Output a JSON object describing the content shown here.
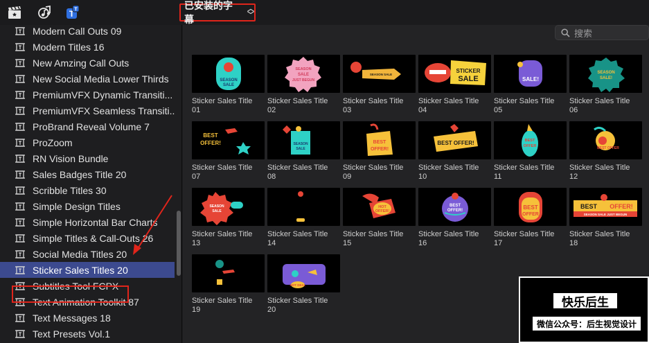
{
  "toolbar": {
    "icons": [
      "clapper-icon",
      "music-icon",
      "titles-icon"
    ],
    "browser_dropdown": "已安装的字幕",
    "accent_color": "#e0251b"
  },
  "sidebar": {
    "items": [
      {
        "label": "Modern Call Outs 09"
      },
      {
        "label": "Modern Titles 16"
      },
      {
        "label": "New Amzing Call Outs"
      },
      {
        "label": "New Social Media Lower Thirds"
      },
      {
        "label": "PremiumVFX Dynamic Transiti..."
      },
      {
        "label": "PremiumVFX Seamless Transiti..."
      },
      {
        "label": "ProBrand Reveal Volume 7"
      },
      {
        "label": "ProZoom"
      },
      {
        "label": "RN Vision Bundle"
      },
      {
        "label": "Sales Badges Title 20"
      },
      {
        "label": "Scribble Titles 30"
      },
      {
        "label": "Simple Design Titles"
      },
      {
        "label": "Simple Horizontal Bar Charts"
      },
      {
        "label": "Simple Titles & Call-Outs 26"
      },
      {
        "label": "Social Media Titles 20"
      },
      {
        "label": "Sticker Sales Titles 20",
        "selected": true
      },
      {
        "label": "Subtitles Tool FCPX"
      },
      {
        "label": "Text Animation Toolkit 87"
      },
      {
        "label": "Text Messages 18"
      },
      {
        "label": "Text Presets Vol.1"
      }
    ],
    "selected_color": "#3c4a8f"
  },
  "search": {
    "placeholder": "搜索"
  },
  "clips": [
    {
      "line1": "Sticker Sales Title",
      "line2": "01",
      "thumb_text": "SEASON SALE"
    },
    {
      "line1": "Sticker Sales Title",
      "line2": "02",
      "thumb_text": "SEASON SALE JUST BEGUN"
    },
    {
      "line1": "Sticker Sales Title",
      "line2": "03",
      "thumb_text": "SEASON SALE JUST BEGUN"
    },
    {
      "line1": "Sticker Sales Title",
      "line2": "04",
      "thumb_text": "STICKER SALE"
    },
    {
      "line1": "Sticker Sales Title",
      "line2": "05",
      "thumb_text": "SALE!"
    },
    {
      "line1": "Sticker Sales Title",
      "line2": "06",
      "thumb_text": "SEASON SALE!"
    },
    {
      "line1": "Sticker Sales Title",
      "line2": "07",
      "thumb_text": "BEST OFFER!"
    },
    {
      "line1": "Sticker Sales Title",
      "line2": "08",
      "thumb_text": "SEASON SALE"
    },
    {
      "line1": "Sticker Sales Title",
      "line2": "09",
      "thumb_text": "BEST OFFER!"
    },
    {
      "line1": "Sticker Sales Title",
      "line2": "10",
      "thumb_text": "BEST OFFER!"
    },
    {
      "line1": "Sticker Sales Title",
      "line2": "11",
      "thumb_text": "BEST OFFER"
    },
    {
      "line1": "Sticker Sales Title",
      "line2": "12",
      "thumb_text": "BEST OFFER"
    },
    {
      "line1": "Sticker Sales Title",
      "line2": "13",
      "thumb_text": "SEASON SALE"
    },
    {
      "line1": "Sticker Sales Title",
      "line2": "14",
      "thumb_text": ""
    },
    {
      "line1": "Sticker Sales Title",
      "line2": "15",
      "thumb_text": "HOT OFFER!"
    },
    {
      "line1": "Sticker Sales Title",
      "line2": "16",
      "thumb_text": "BEST OFFER!"
    },
    {
      "line1": "Sticker Sales Title",
      "line2": "17",
      "thumb_text": "BEST OFFER"
    },
    {
      "line1": "Sticker Sales Title",
      "line2": "18",
      "thumb_text": "BEST OFFER!"
    },
    {
      "line1": "Sticker Sales Title",
      "line2": "19",
      "thumb_text": ""
    },
    {
      "line1": "Sticker Sales Title",
      "line2": "20",
      "thumb_text": "HOT DEAL"
    }
  ],
  "watermark": {
    "title": "快乐后生",
    "subtitle": "微信公众号：后生视觉设计"
  }
}
